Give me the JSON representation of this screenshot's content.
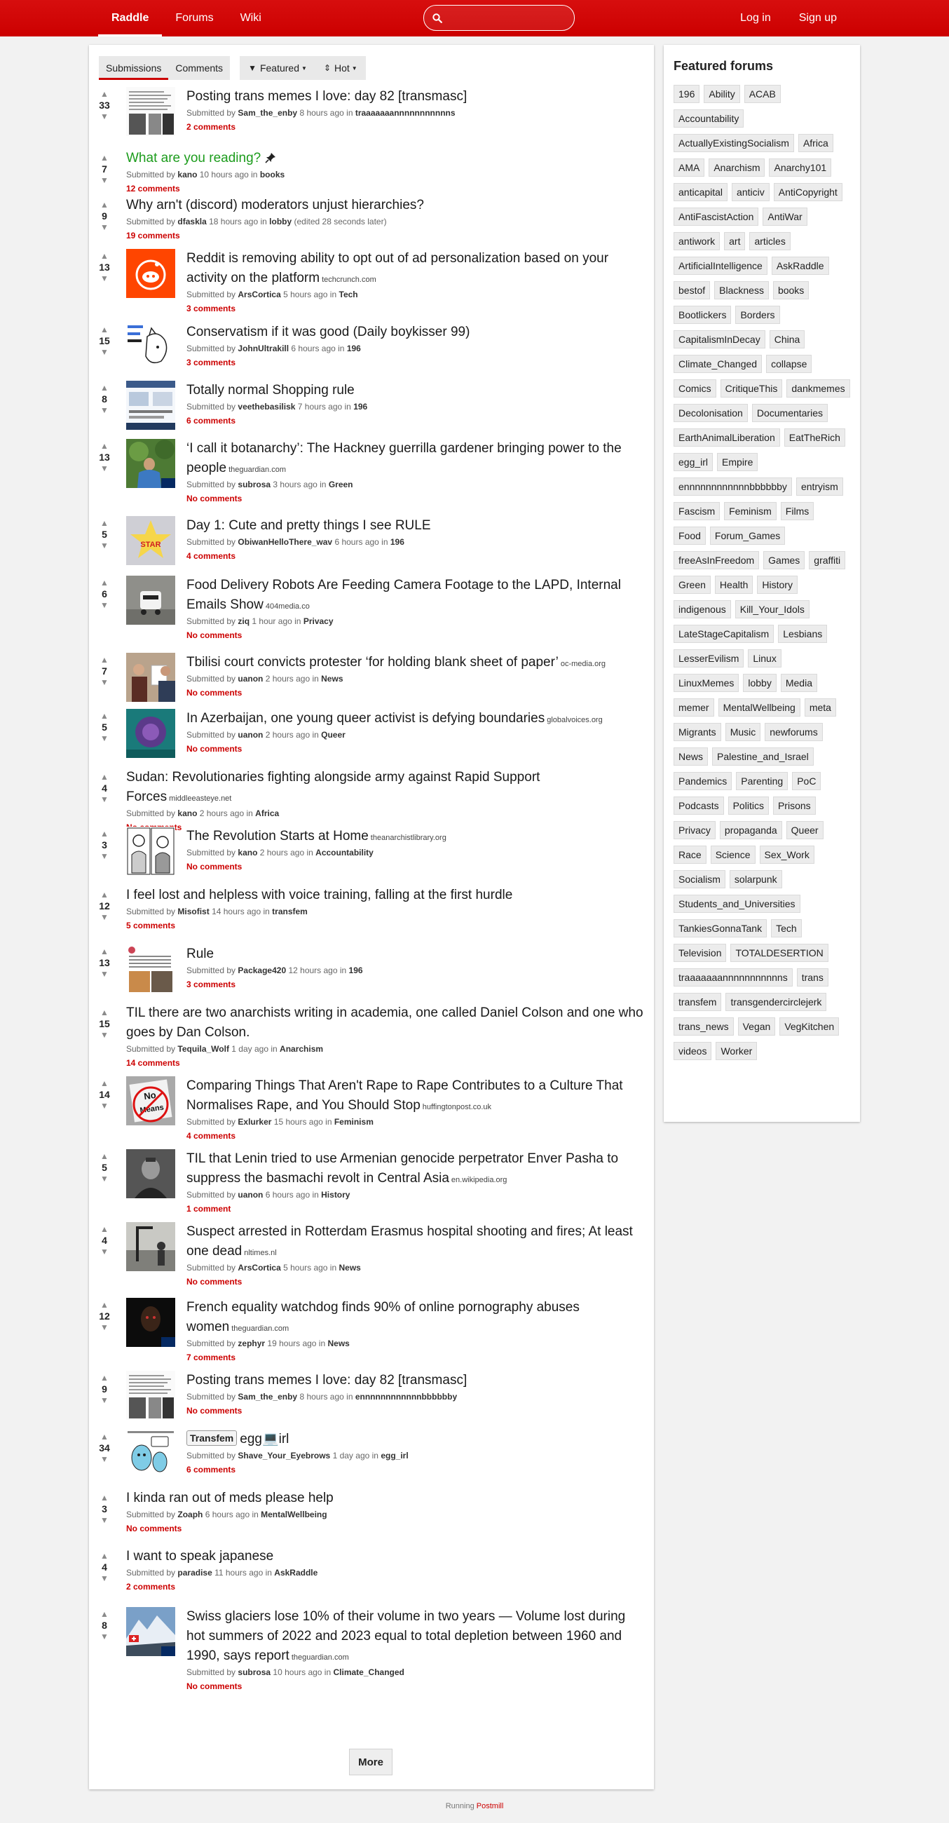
{
  "nav": {
    "brand": "Raddle",
    "forums": "Forums",
    "wiki": "Wiki",
    "search_placeholder": "",
    "login": "Log in",
    "signup": "Sign up"
  },
  "toolbar": {
    "tab_submissions": "Submissions",
    "tab_comments": "Comments",
    "featured": "Featured",
    "hot": "Hot"
  },
  "submissions": [
    {
      "score": "33",
      "title": "Posting trans memes I love: day 82 [transmasc]",
      "domain": "",
      "submitted": "Submitted by",
      "user": "Sam_the_enby",
      "time": "8 hours ago in",
      "forum": "traaaaaaannnnnnnnnnns",
      "edited": "",
      "comments": "2 comments",
      "thumb": "text"
    },
    {
      "score": "7",
      "title": "What are you reading?",
      "domain": "",
      "submitted": "Submitted by",
      "user": "kano",
      "time": "10 hours ago in",
      "forum": "books",
      "edited": "",
      "comments": "12 comments",
      "thumb": "",
      "sticky": true
    },
    {
      "score": "9",
      "title": "Why arn't (discord) moderators unjust hierarchies?",
      "domain": "",
      "submitted": "Submitted by",
      "user": "dfaskla",
      "time": "18 hours ago in",
      "forum": "lobby",
      "edited": "(edited 28 seconds later)",
      "comments": "19 comments",
      "thumb": ""
    },
    {
      "score": "13",
      "title": "Reddit is removing ability to opt out of ad personalization based on your activity on the platform",
      "domain": "techcrunch.com",
      "submitted": "Submitted by",
      "user": "ArsCortica",
      "time": "5 hours ago in",
      "forum": "Tech",
      "edited": "",
      "comments": "3 comments",
      "thumb": "reddit"
    },
    {
      "score": "15",
      "title": "Conservatism if it was good (Daily boykisser 99)",
      "domain": "",
      "submitted": "Submitted by",
      "user": "JohnUltrakill",
      "time": "6 hours ago in",
      "forum": "196",
      "edited": "",
      "comments": "3 comments",
      "thumb": "cat"
    },
    {
      "score": "8",
      "title": "Totally normal Shopping rule",
      "domain": "",
      "submitted": "Submitted by",
      "user": "veethebasilisk",
      "time": "7 hours ago in",
      "forum": "196",
      "edited": "",
      "comments": "6 comments",
      "thumb": "shop"
    },
    {
      "score": "13",
      "title": "‘I call it botanarchy’: The Hackney guerrilla gardener bringing power to the people",
      "domain": "theguardian.com",
      "submitted": "Submitted by",
      "user": "subrosa",
      "time": "3 hours ago in",
      "forum": "Green",
      "edited": "",
      "comments": "No comments",
      "thumb": "garden"
    },
    {
      "score": "5",
      "title": "Day 1: Cute and pretty things I see RULE",
      "domain": "",
      "submitted": "Submitted by",
      "user": "ObiwanHelloThere_wav",
      "time": "6 hours ago in",
      "forum": "196",
      "edited": "",
      "comments": "4 comments",
      "thumb": "star"
    },
    {
      "score": "6",
      "title": "Food Delivery Robots Are Feeding Camera Footage to the LAPD, Internal Emails Show",
      "domain": "404media.co",
      "submitted": "Submitted by",
      "user": "ziq",
      "time": "1 hour ago in",
      "forum": "Privacy",
      "edited": "",
      "comments": "No comments",
      "thumb": "robot"
    },
    {
      "score": "7",
      "title": "Tbilisi court convicts protester ‘for holding blank sheet of paper’",
      "domain": "oc-media.org",
      "submitted": "Submitted by",
      "user": "uanon",
      "time": "2 hours ago in",
      "forum": "News",
      "edited": "",
      "comments": "No comments",
      "thumb": "protest"
    },
    {
      "score": "5",
      "title": "In Azerbaijan, one young queer activist is defying boundaries",
      "domain": "globalvoices.org",
      "submitted": "Submitted by",
      "user": "uanon",
      "time": "2 hours ago in",
      "forum": "Queer",
      "edited": "",
      "comments": "No comments",
      "thumb": "queer"
    },
    {
      "score": "4",
      "title": "Sudan: Revolutionaries fighting alongside army against Rapid Support Forces",
      "domain": "middleeasteye.net",
      "submitted": "Submitted by",
      "user": "kano",
      "time": "2 hours ago in",
      "forum": "Africa",
      "edited": "",
      "comments": "No comments",
      "thumb": ""
    },
    {
      "score": "3",
      "title": "The Revolution Starts at Home",
      "domain": "theanarchistlibrary.org",
      "submitted": "Submitted by",
      "user": "kano",
      "time": "2 hours ago in",
      "forum": "Accountability",
      "edited": "",
      "comments": "No comments",
      "thumb": "comic"
    },
    {
      "score": "12",
      "title": "I feel lost and helpless with voice training, falling at the first hurdle",
      "domain": "",
      "submitted": "Submitted by",
      "user": "Misofist",
      "time": "14 hours ago in",
      "forum": "transfem",
      "edited": "",
      "comments": "5 comments",
      "thumb": ""
    },
    {
      "score": "13",
      "title": "Rule",
      "domain": "",
      "submitted": "Submitted by",
      "user": "Package420",
      "time": "12 hours ago in",
      "forum": "196",
      "edited": "",
      "comments": "3 comments",
      "thumb": "post"
    },
    {
      "score": "15",
      "title": "TIL there are two anarchists writing in academia, one called Daniel Colson and one who goes by Dan Colson.",
      "domain": "",
      "submitted": "Submitted by",
      "user": "Tequila_Wolf",
      "time": "1 day ago in",
      "forum": "Anarchism",
      "edited": "",
      "comments": "14 comments",
      "thumb": ""
    },
    {
      "score": "14",
      "title": "Comparing Things That Aren't Rape to Rape Contributes to a Culture That Normalises Rape, and You Should Stop",
      "domain": "huffingtonpost.co.uk",
      "submitted": "Submitted by",
      "user": "Exlurker",
      "time": "15 hours ago in",
      "forum": "Feminism",
      "edited": "",
      "comments": "4 comments",
      "thumb": "sign"
    },
    {
      "score": "5",
      "title": "TIL that Lenin tried to use Armenian genocide perpetrator Enver Pasha to suppress the basmachi revolt in Central Asia",
      "domain": "en.wikipedia.org",
      "submitted": "Submitted by",
      "user": "uanon",
      "time": "6 hours ago in",
      "forum": "History",
      "edited": "",
      "comments": "1 comment",
      "thumb": "portrait"
    },
    {
      "score": "4",
      "title": "Suspect arrested in Rotterdam Erasmus hospital shooting and fires; At least one dead",
      "domain": "nltimes.nl",
      "submitted": "Submitted by",
      "user": "ArsCortica",
      "time": "5 hours ago in",
      "forum": "News",
      "edited": "",
      "comments": "No comments",
      "thumb": "street"
    },
    {
      "score": "12",
      "title": "French equality watchdog finds 90% of online pornography abuses women",
      "domain": "theguardian.com",
      "submitted": "Submitted by",
      "user": "zephyr",
      "time": "19 hours ago in",
      "forum": "News",
      "edited": "",
      "comments": "7 comments",
      "thumb": "dark"
    },
    {
      "score": "9",
      "title": "Posting trans memes I love: day 82 [transmasc]",
      "domain": "",
      "submitted": "Submitted by",
      "user": "Sam_the_enby",
      "time": "8 hours ago in",
      "forum": "ennnnnnnnnnnnbbbbbby",
      "edited": "",
      "comments": "No comments",
      "thumb": "text"
    },
    {
      "score": "34",
      "title": "egg💻irl",
      "flair": "Transfem",
      "domain": "",
      "submitted": "Submitted by",
      "user": "Shave_Your_Eyebrows",
      "time": "1 day ago in",
      "forum": "egg_irl",
      "edited": "",
      "comments": "6 comments",
      "thumb": "egg"
    },
    {
      "score": "3",
      "title": "I kinda ran out of meds please help",
      "domain": "",
      "submitted": "Submitted by",
      "user": "Zoaph",
      "time": "6 hours ago in",
      "forum": "MentalWellbeing",
      "edited": "",
      "comments": "No comments",
      "thumb": ""
    },
    {
      "score": "4",
      "title": "I want to speak japanese",
      "domain": "",
      "submitted": "Submitted by",
      "user": "paradise",
      "time": "11 hours ago in",
      "forum": "AskRaddle",
      "edited": "",
      "comments": "2 comments",
      "thumb": ""
    },
    {
      "score": "8",
      "title": "Swiss glaciers lose 10% of their volume in two years — Volume lost during hot summers of 2022 and 2023 equal to total depletion between 1960 and 1990, says report",
      "domain": "theguardian.com",
      "submitted": "Submitted by",
      "user": "subrosa",
      "time": "10 hours ago in",
      "forum": "Climate_Changed",
      "edited": "",
      "comments": "No comments",
      "thumb": "glacier"
    }
  ],
  "more_button": "More",
  "sidebar": {
    "title": "Featured forums",
    "forums": [
      "196",
      "Ability",
      "ACAB",
      "Accountability",
      "ActuallyExistingSocialism",
      "Africa",
      "AMA",
      "Anarchism",
      "Anarchy101",
      "anticapital",
      "anticiv",
      "AntiCopyright",
      "AntiFascistAction",
      "AntiWar",
      "antiwork",
      "art",
      "articles",
      "ArtificialIntelligence",
      "AskRaddle",
      "bestof",
      "Blackness",
      "books",
      "Bootlickers",
      "Borders",
      "CapitalismInDecay",
      "China",
      "Climate_Changed",
      "collapse",
      "Comics",
      "CritiqueThis",
      "dankmemes",
      "Decolonisation",
      "Documentaries",
      "EarthAnimalLiberation",
      "EatTheRich",
      "egg_irl",
      "Empire",
      "ennnnnnnnnnnnbbbbbby",
      "entryism",
      "Fascism",
      "Feminism",
      "Films",
      "Food",
      "Forum_Games",
      "freeAsInFreedom",
      "Games",
      "graffiti",
      "Green",
      "Health",
      "History",
      "indigenous",
      "Kill_Your_Idols",
      "LateStageCapitalism",
      "Lesbians",
      "LesserEvilism",
      "Linux",
      "LinuxMemes",
      "lobby",
      "Media",
      "memer",
      "MentalWellbeing",
      "meta",
      "Migrants",
      "Music",
      "newforums",
      "News",
      "Palestine_and_Israel",
      "Pandemics",
      "Parenting",
      "PoC",
      "Podcasts",
      "Politics",
      "Prisons",
      "Privacy",
      "propaganda",
      "Queer",
      "Race",
      "Science",
      "Sex_Work",
      "Socialism",
      "solarpunk",
      "Students_and_Universities",
      "TankiesGonnaTank",
      "Tech",
      "Television",
      "TOTALDESERTION",
      "traaaaaaannnnnnnnnnns",
      "trans",
      "transfem",
      "transgendercirclejerk",
      "trans_news",
      "Vegan",
      "VegKitchen",
      "videos",
      "Worker"
    ]
  },
  "footer": {
    "running": "Running",
    "postmill": "Postmill"
  },
  "colors": {
    "navbar": "#cc0000",
    "accent": "#cc0000",
    "sticky_title": "#1c9c1c"
  }
}
